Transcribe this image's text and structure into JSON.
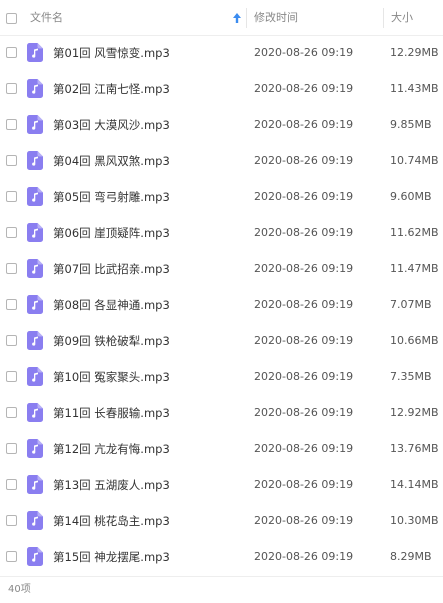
{
  "header": {
    "name_label": "文件名",
    "date_label": "修改时间",
    "size_label": "大小",
    "sort_icon": "arrow-up-icon"
  },
  "files": [
    {
      "name": "第01回 风雪惊变.mp3",
      "date": "2020-08-26 09:19",
      "size": "12.29MB"
    },
    {
      "name": "第02回 江南七怪.mp3",
      "date": "2020-08-26 09:19",
      "size": "11.43MB"
    },
    {
      "name": "第03回 大漠风沙.mp3",
      "date": "2020-08-26 09:19",
      "size": "9.85MB"
    },
    {
      "name": "第04回 黑风双煞.mp3",
      "date": "2020-08-26 09:19",
      "size": "10.74MB"
    },
    {
      "name": "第05回 弯弓射雕.mp3",
      "date": "2020-08-26 09:19",
      "size": "9.60MB"
    },
    {
      "name": "第06回 崖顶疑阵.mp3",
      "date": "2020-08-26 09:19",
      "size": "11.62MB"
    },
    {
      "name": "第07回 比武招亲.mp3",
      "date": "2020-08-26 09:19",
      "size": "11.47MB"
    },
    {
      "name": "第08回 各显神通.mp3",
      "date": "2020-08-26 09:19",
      "size": "7.07MB"
    },
    {
      "name": "第09回 铁枪破犁.mp3",
      "date": "2020-08-26 09:19",
      "size": "10.66MB"
    },
    {
      "name": "第10回 冤家聚头.mp3",
      "date": "2020-08-26 09:19",
      "size": "7.35MB"
    },
    {
      "name": "第11回 长春服输.mp3",
      "date": "2020-08-26 09:19",
      "size": "12.92MB"
    },
    {
      "name": "第12回 亢龙有悔.mp3",
      "date": "2020-08-26 09:19",
      "size": "13.76MB"
    },
    {
      "name": "第13回 五湖废人.mp3",
      "date": "2020-08-26 09:19",
      "size": "14.14MB"
    },
    {
      "name": "第14回 桃花岛主.mp3",
      "date": "2020-08-26 09:19",
      "size": "10.30MB"
    },
    {
      "name": "第15回 神龙摆尾.mp3",
      "date": "2020-08-26 09:19",
      "size": "8.29MB"
    }
  ],
  "footer": {
    "count": "40项"
  },
  "colors": {
    "accent": "#3b8cf0",
    "file_icon": "#8a7ef0"
  }
}
